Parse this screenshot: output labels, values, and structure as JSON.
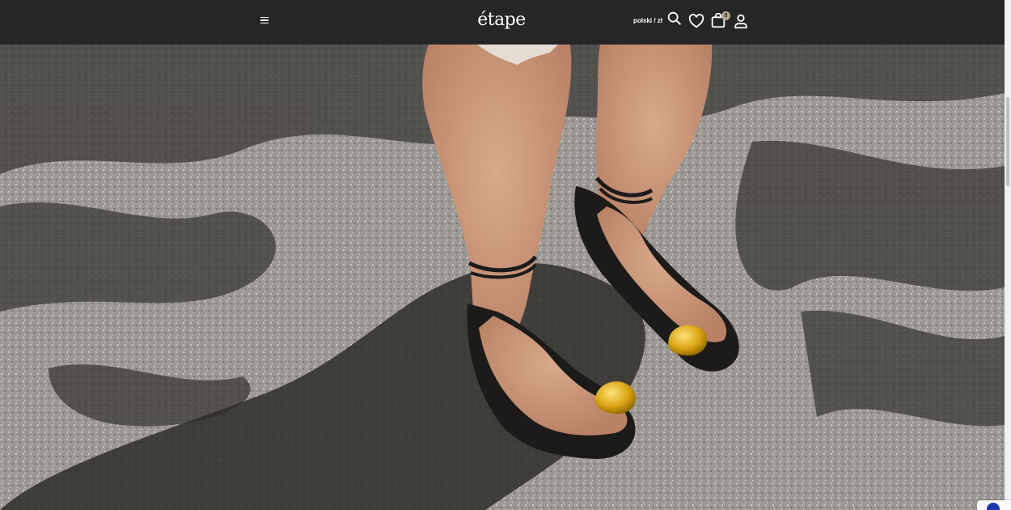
{
  "header": {
    "logo": "étape",
    "language_currency": "polski / zł",
    "cart_count": "0"
  },
  "icons": {
    "menu": "hamburger-menu-icon",
    "search": "search-icon",
    "wishlist": "heart-icon",
    "cart": "shopping-bag-icon",
    "account": "user-icon"
  },
  "colors": {
    "header_bg": "#262626",
    "badge": "#b7a78a",
    "header_text": "#ffffff"
  }
}
